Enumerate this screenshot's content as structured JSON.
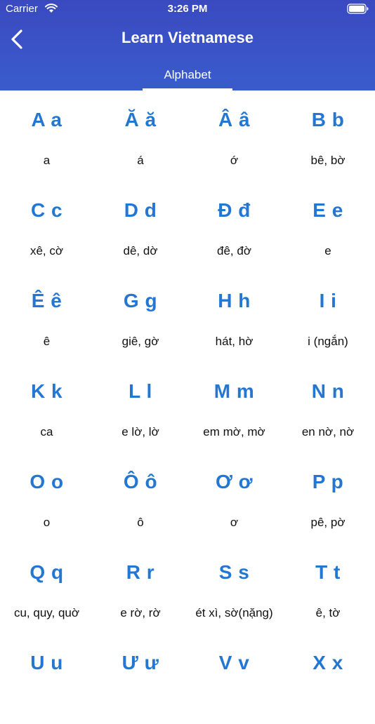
{
  "status_bar": {
    "carrier": "Carrier",
    "time": "3:26 PM"
  },
  "nav": {
    "title": "Learn Vietnamese",
    "back_icon": "chevron-left-icon"
  },
  "tab": {
    "label": "Alphabet"
  },
  "colors": {
    "header": "#3a52c5",
    "letter": "#2377d3",
    "text": "#111111"
  },
  "alphabet": [
    {
      "letter": "A a",
      "pron": "a"
    },
    {
      "letter": "Ă ă",
      "pron": "á"
    },
    {
      "letter": "Â â",
      "pron": "ớ"
    },
    {
      "letter": "B b",
      "pron": "bê, bờ"
    },
    {
      "letter": "C c",
      "pron": "xê, cờ"
    },
    {
      "letter": "D d",
      "pron": "dê, dờ"
    },
    {
      "letter": "Đ đ",
      "pron": "đê, đờ"
    },
    {
      "letter": "E e",
      "pron": "e"
    },
    {
      "letter": "Ê ê",
      "pron": "ê"
    },
    {
      "letter": "G g",
      "pron": "giê, gờ"
    },
    {
      "letter": "H h",
      "pron": "hát, hờ"
    },
    {
      "letter": "I i",
      "pron": "i (ngắn)"
    },
    {
      "letter": "K k",
      "pron": "ca"
    },
    {
      "letter": "L l",
      "pron": "e lờ, lờ"
    },
    {
      "letter": "M m",
      "pron": "em mờ, mờ"
    },
    {
      "letter": "N n",
      "pron": "en nờ, nờ"
    },
    {
      "letter": "O o",
      "pron": "o"
    },
    {
      "letter": "Ô ô",
      "pron": "ô"
    },
    {
      "letter": "Ơ ơ",
      "pron": "ơ"
    },
    {
      "letter": "P p",
      "pron": "pê, pờ"
    },
    {
      "letter": "Q q",
      "pron": "cu, quy, quờ"
    },
    {
      "letter": "R r",
      "pron": "e rờ, rờ"
    },
    {
      "letter": "S s",
      "pron": "ét xì, sờ(nặng)"
    },
    {
      "letter": "T t",
      "pron": "ê, tờ"
    },
    {
      "letter": "U u",
      "pron": ""
    },
    {
      "letter": "Ư ư",
      "pron": ""
    },
    {
      "letter": "V v",
      "pron": ""
    },
    {
      "letter": "X x",
      "pron": ""
    }
  ]
}
